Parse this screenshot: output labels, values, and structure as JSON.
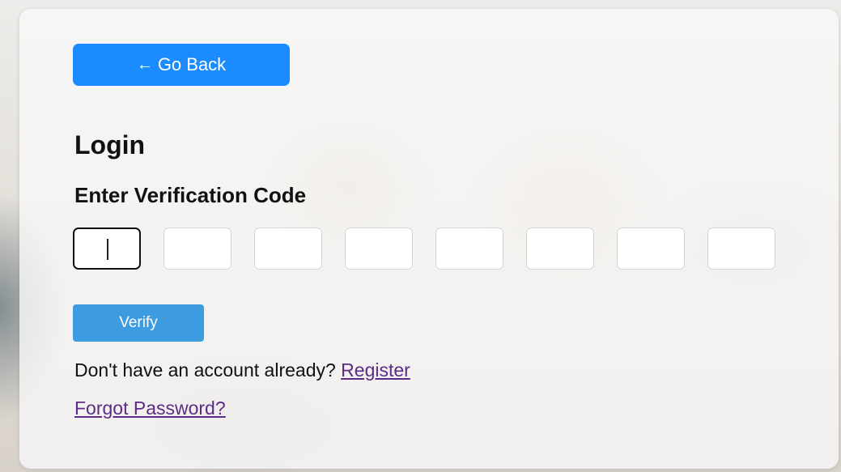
{
  "back_button": {
    "label": "Go Back",
    "icon": "left-arrow-icon",
    "arrow_glyph": "←"
  },
  "heading": {
    "title": "Login",
    "subtitle": "Enter Verification Code"
  },
  "code_inputs": {
    "count": 8,
    "values": [
      "",
      "",
      "",
      "",
      "",
      "",
      "",
      ""
    ],
    "focused_index": 0
  },
  "verify_button": {
    "label": "Verify"
  },
  "register_prompt": {
    "text": "Don't have an account already?",
    "link_label": "Register"
  },
  "forgot_password": {
    "label": "Forgot Password?"
  },
  "colors": {
    "back_button_bg": "#1a8cff",
    "verify_button_bg": "#3d9be0",
    "link": "#5b2c86"
  }
}
